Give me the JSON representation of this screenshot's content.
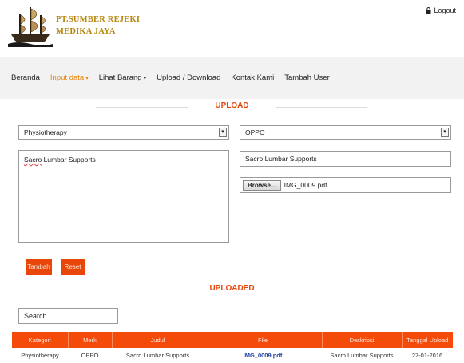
{
  "header": {
    "company_line1": "PT.SUMBER REJEKI",
    "company_line2": "MEDIKA JAYA",
    "logout_label": "Logout",
    "logo_icon": "sailing-ship-icon",
    "brand_color": "#b8860b"
  },
  "nav": {
    "items": [
      {
        "label": "Beranda",
        "has_dropdown": false
      },
      {
        "label": "Input data",
        "has_dropdown": true
      },
      {
        "label": "Lihat Barang",
        "has_dropdown": true
      },
      {
        "label": "Upload / Download",
        "has_dropdown": false
      },
      {
        "label": "Kontak Kami",
        "has_dropdown": false
      },
      {
        "label": "Tambah User",
        "has_dropdown": false
      }
    ],
    "active_color": "#e8840a"
  },
  "upload": {
    "title": "UPLOAD",
    "kategori_selected": "Physiotherapy",
    "merk_selected": "OPPO",
    "deskripsi_value_squiggle": "Sacro",
    "deskripsi_value_rest": " Lumbar Supports",
    "judul_value": "Sacro Lumbar Supports",
    "browse_label": "Browse...",
    "file_name": "IMG_0009.pdf",
    "tambah_label": "Tambah",
    "reset_label": "Reset",
    "accent_color": "#e8460a"
  },
  "uploaded": {
    "title": "UPLOADED",
    "search_placeholder": "Search",
    "columns": [
      "Kategori",
      "Merk",
      "Judul",
      "File",
      "Deskripsi",
      "Tanggal Upload"
    ],
    "rows": [
      [
        "Physiotherapy",
        "OPPO",
        "Sacro Lumbar Supports",
        "IMG_0009.pdf",
        "Sacro Lumbar Supports",
        "27-01-2016"
      ]
    ]
  }
}
